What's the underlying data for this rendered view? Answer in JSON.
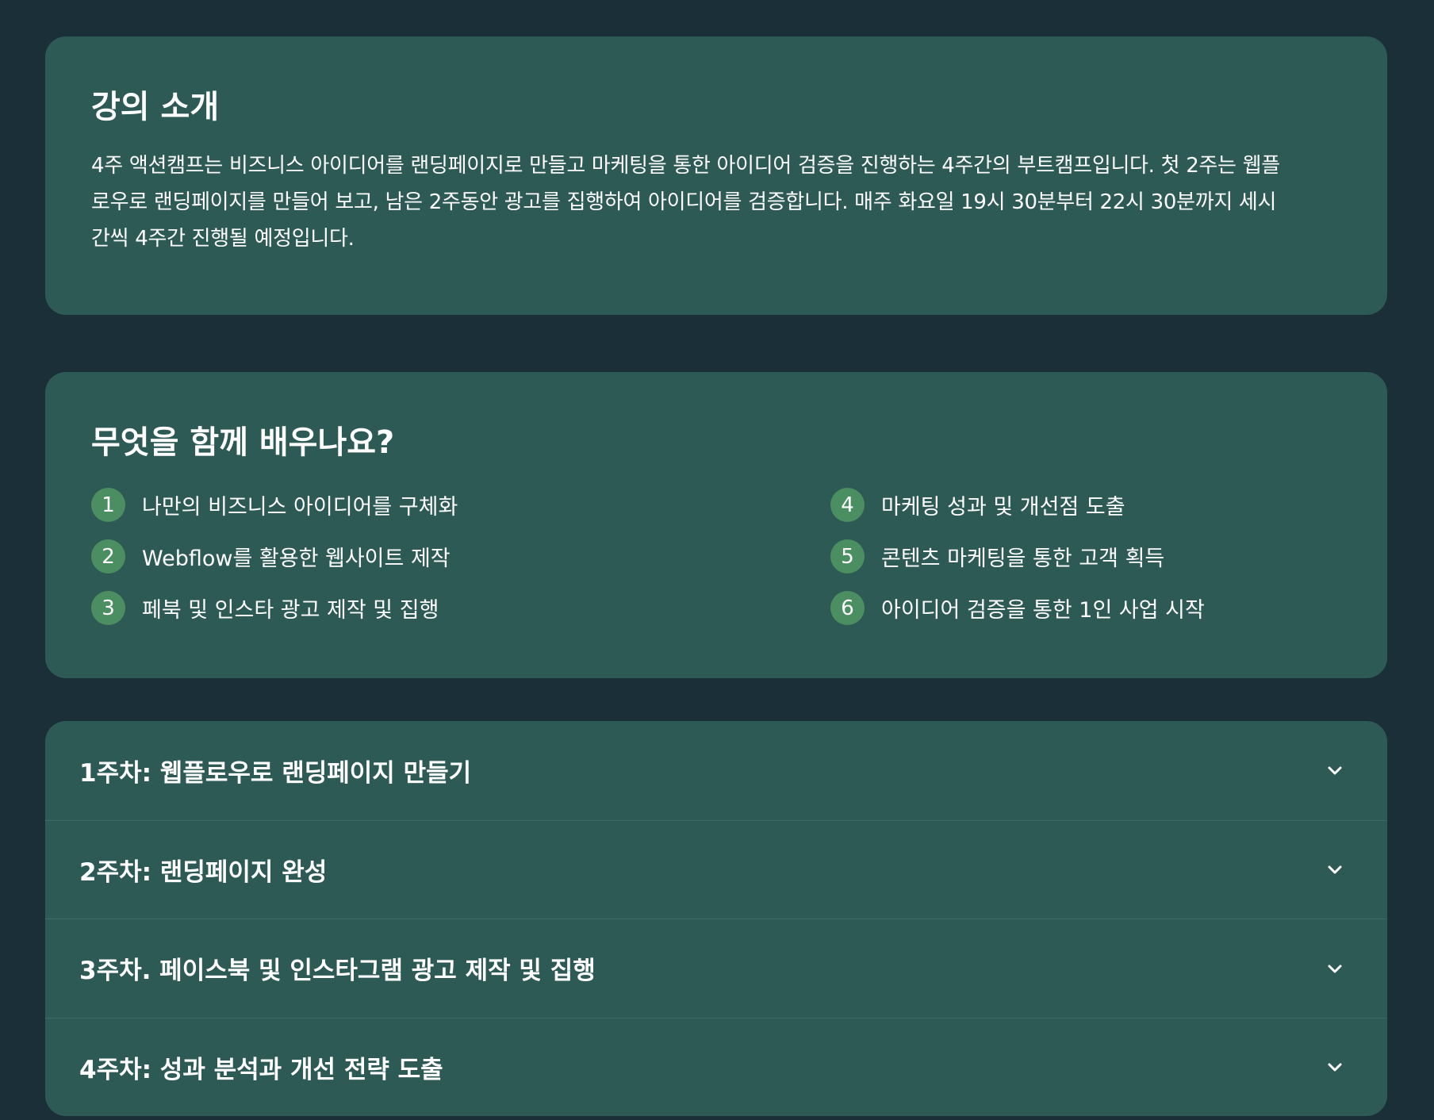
{
  "intro": {
    "title": "강의 소개",
    "line1": "4주 액션캠프는 비즈니스 아이디어를 랜딩페이지로 만들고 마케팅을 통한 아이디어 검증을 진행하는 4주간의 부트캠프입니다. 첫 2주는 웹플",
    "line2": "로우로 랜딩페이지를 만들어 보고, 남은 2주동안 광고를 집행하여 아이디어를 검증합니다. 매주 화요일 19시 30분부터 22시 30분까지 세시",
    "line3": "간씩 4주간 진행될 예정입니다."
  },
  "learn": {
    "title": "무엇을 함께 배우나요?",
    "items": [
      {
        "num": "1",
        "text": "나만의 비즈니스 아이디어를 구체화"
      },
      {
        "num": "2",
        "text": "Webflow를 활용한 웹사이트 제작"
      },
      {
        "num": "3",
        "text": "페북 및 인스타 광고 제작 및 집행"
      },
      {
        "num": "4",
        "text": "마케팅 성과 및 개선점 도출"
      },
      {
        "num": "5",
        "text": "콘텐츠 마케팅을 통한 고객 획득"
      },
      {
        "num": "6",
        "text": "아이디어 검증을 통한 1인 사업 시작"
      }
    ],
    "badge_color": "#4a8e61"
  },
  "weeks": {
    "items": [
      {
        "title": "1주차: 웹플로우로 랜딩페이지 만들기"
      },
      {
        "title": "2주차: 랜딩페이지 완성"
      },
      {
        "title": "3주차. 페이스북 및 인스타그램 광고 제작 및 집행"
      },
      {
        "title": "4주차: 성과 분석과 개선 전략 도출"
      }
    ],
    "toggle_icon": "chevron-down-icon"
  },
  "colors": {
    "background": "#1b2f38",
    "card": "#2e5a56",
    "text": "#ffffff"
  }
}
